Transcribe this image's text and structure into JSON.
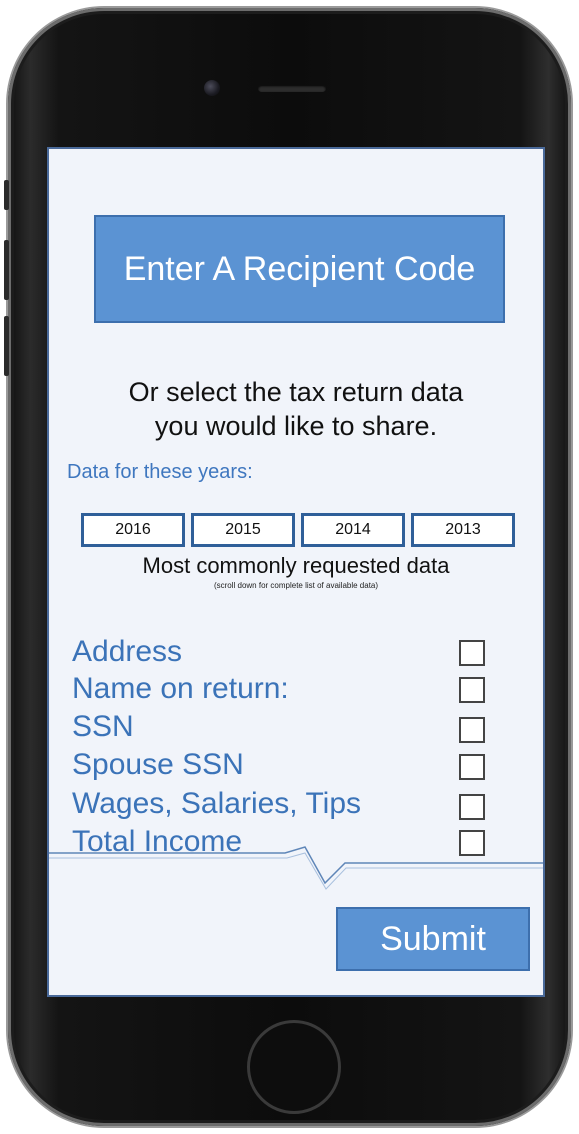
{
  "screen": {
    "recipient_button": "Enter A Recipient Code",
    "instructions": {
      "line1": "Or select the tax return data",
      "line2": "you would like to share."
    },
    "years_label": "Data for these years:",
    "years": [
      "2016",
      "2015",
      "2014",
      "2013"
    ],
    "common_label": "Most commonly requested data",
    "scroll_note": "(scroll down for complete list of available data)",
    "fields": [
      {
        "label": "Address",
        "checked": false
      },
      {
        "label": "Name on return:",
        "checked": false
      },
      {
        "label": "SSN",
        "checked": false
      },
      {
        "label": "Spouse SSN",
        "checked": false
      },
      {
        "label": "Wages, Salaries, Tips",
        "checked": false
      },
      {
        "label": "Total Income",
        "checked": false
      }
    ],
    "submit_label": "Submit"
  },
  "colors": {
    "accent": "#5b93d3",
    "accent_border": "#3d6fad",
    "label_blue": "#3b73b8",
    "screen_bg": "#f1f4fa",
    "year_border": "#2f5f99"
  }
}
